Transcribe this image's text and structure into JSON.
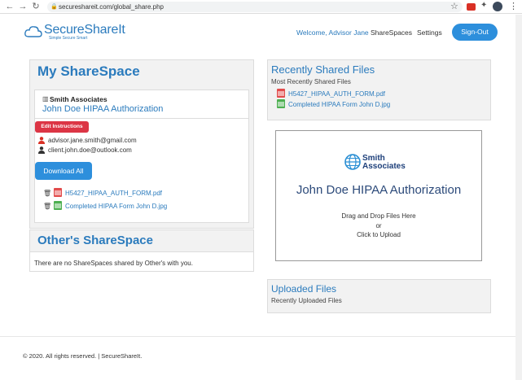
{
  "browser": {
    "url": "secureshareit.com/global_share.php",
    "icons": [
      "back-icon",
      "forward-icon",
      "reload-icon",
      "lock-icon",
      "star-icon",
      "extension-icon",
      "puzzle-icon",
      "profile-icon",
      "menu-icon"
    ]
  },
  "header": {
    "logo_text": "SecureShareIt",
    "logo_tagline": "Simple Secure Smart",
    "welcome": "Welcome, Advisor Jane",
    "nav_sharespaces": "ShareSpaces",
    "nav_settings": "Settings",
    "signout": "Sign-Out"
  },
  "my_sharespace": {
    "title": "My ShareSpace",
    "company": "Smith Associates",
    "share_title": "John Doe HIPAA Authorization",
    "edit_button": "Edit Instructions",
    "emails": [
      "advisor.jane.smith@gmail.com",
      "client.john.doe@outlook.com"
    ],
    "download_all": "Download All",
    "files": [
      {
        "name": "H5427_HIPAA_AUTH_FORM.pdf",
        "type": "pdf"
      },
      {
        "name": "Completed HIPAA Form John D.jpg",
        "type": "image"
      }
    ]
  },
  "others_sharespace": {
    "title": "Other's ShareSpace",
    "empty_text": "There are no ShareSpaces shared by Other's with you."
  },
  "recently_shared": {
    "title": "Recently Shared Files",
    "subtitle": "Most Recently Shared Files",
    "files": [
      {
        "name": "H5427_HIPAA_AUTH_FORM.pdf",
        "type": "pdf"
      },
      {
        "name": "Completed HIPAA Form John D.jpg",
        "type": "image"
      }
    ]
  },
  "upload_box": {
    "logo_line1": "Smith",
    "logo_line2": "Associates",
    "title": "John Doe HIPAA Authorization",
    "line1": "Drag and Drop Files Here",
    "line2": "or",
    "line3": "Click to Upload"
  },
  "uploaded_files": {
    "title": "Uploaded Files",
    "subtitle": "Recently Uploaded Files"
  },
  "footer": {
    "text": "© 2020. All rights reserved. | SecureShareIt."
  },
  "colors": {
    "accent": "#2b7bbd",
    "button_blue": "#2d8fdc",
    "danger": "#dc3545",
    "panel_bg": "#f2f2f2"
  }
}
